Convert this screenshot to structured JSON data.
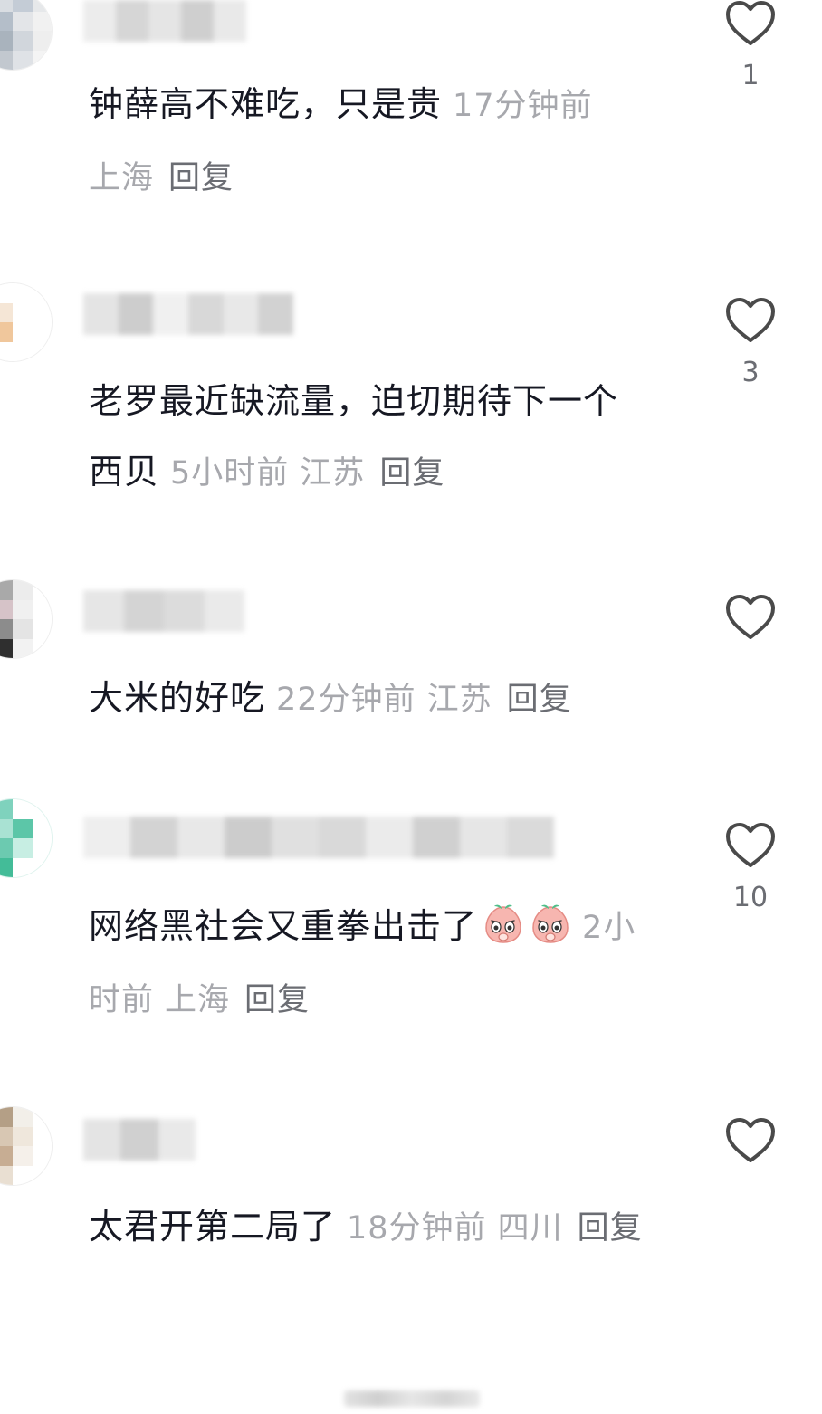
{
  "comments": [
    {
      "text": "钟薛高不难吃，只是贵",
      "time": "17分钟前",
      "location": "上海",
      "reply_label": "回复",
      "likes": "1"
    },
    {
      "text": "老罗最近缺流量，迫切期待下一个西贝",
      "time": "5小时前",
      "location": "江苏",
      "reply_label": "回复",
      "likes": "3"
    },
    {
      "text": "大米的好吃",
      "time": "22分钟前",
      "location": "江苏",
      "reply_label": "回复",
      "likes": ""
    },
    {
      "text": "网络黑社会又重拳出击了",
      "emojis": [
        "blush-peach-emoji",
        "blush-peach-emoji"
      ],
      "time": "2小时前",
      "location": "上海",
      "reply_label": "回复",
      "likes": "10"
    },
    {
      "text": "太君开第二局了",
      "time": "18分钟前",
      "location": "四川",
      "reply_label": "回复",
      "likes": ""
    }
  ],
  "icons": {
    "like": "heart-outline-icon"
  },
  "colors": {
    "text": "#161823",
    "meta": "#a7a8ad",
    "reply": "#6b6d73",
    "icon": "#4a4a4a"
  }
}
